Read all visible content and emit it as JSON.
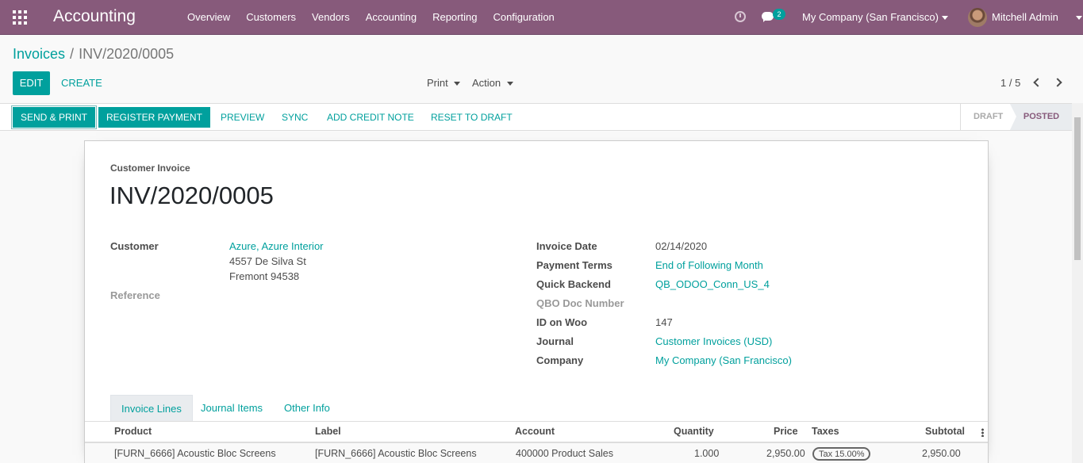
{
  "navbar": {
    "app_title": "Accounting",
    "menu": [
      "Overview",
      "Customers",
      "Vendors",
      "Accounting",
      "Reporting",
      "Configuration"
    ],
    "chat_count": "2",
    "company": "My Company (San Francisco)",
    "user": "Mitchell Admin",
    "icons": [
      "apps-grid-icon",
      "clock-icon",
      "chat-icon",
      "avatar"
    ]
  },
  "control_panel": {
    "breadcrumb_parent": "Invoices",
    "breadcrumb_sep": "/",
    "breadcrumb_current": "INV/2020/0005",
    "edit": "EDIT",
    "create": "CREATE",
    "print": "Print",
    "action": "Action",
    "pager": "1 / 5"
  },
  "statusbar": {
    "buttons": [
      "SEND & PRINT",
      "REGISTER PAYMENT",
      "PREVIEW",
      "SYNC",
      "ADD CREDIT NOTE",
      "RESET TO DRAFT"
    ],
    "stages": [
      "DRAFT",
      "POSTED"
    ],
    "current_stage": "POSTED"
  },
  "invoice": {
    "type": "Customer Invoice",
    "name": "INV/2020/0005",
    "customer_label": "Customer",
    "customer_name": "Azure, Azure Interior",
    "customer_street": "4557 De Silva St",
    "customer_city": "Fremont 94538",
    "reference_label": "Reference",
    "fields": [
      {
        "label": "Invoice Date",
        "value": "02/14/2020"
      },
      {
        "label": "Payment Terms",
        "value": "End of Following Month"
      },
      {
        "label": "Quick Backend",
        "value": "QB_ODOO_Conn_US_4"
      },
      {
        "label": "QBO Doc Number",
        "value": ""
      },
      {
        "label": "ID on Woo",
        "value": "147"
      },
      {
        "label": "Journal",
        "value": "Customer Invoices (USD)"
      },
      {
        "label": "Company",
        "value": "My Company (San Francisco)"
      }
    ]
  },
  "tabs": [
    "Invoice Lines",
    "Journal Items",
    "Other Info"
  ],
  "lines": {
    "headers": [
      "Product",
      "Label",
      "Account",
      "Quantity",
      "Price",
      "Taxes",
      "Subtotal"
    ],
    "rows": [
      {
        "product": "[FURN_6666] Acoustic Bloc Screens",
        "label": "[FURN_6666] Acoustic Bloc Screens",
        "account": "400000 Product Sales",
        "quantity": "1.000",
        "price": "2,950.00",
        "taxes": "Tax 15.00%",
        "subtotal": "2,950.00"
      }
    ]
  },
  "colors": {
    "brand": "#875a7b",
    "primary": "#00a09d"
  }
}
